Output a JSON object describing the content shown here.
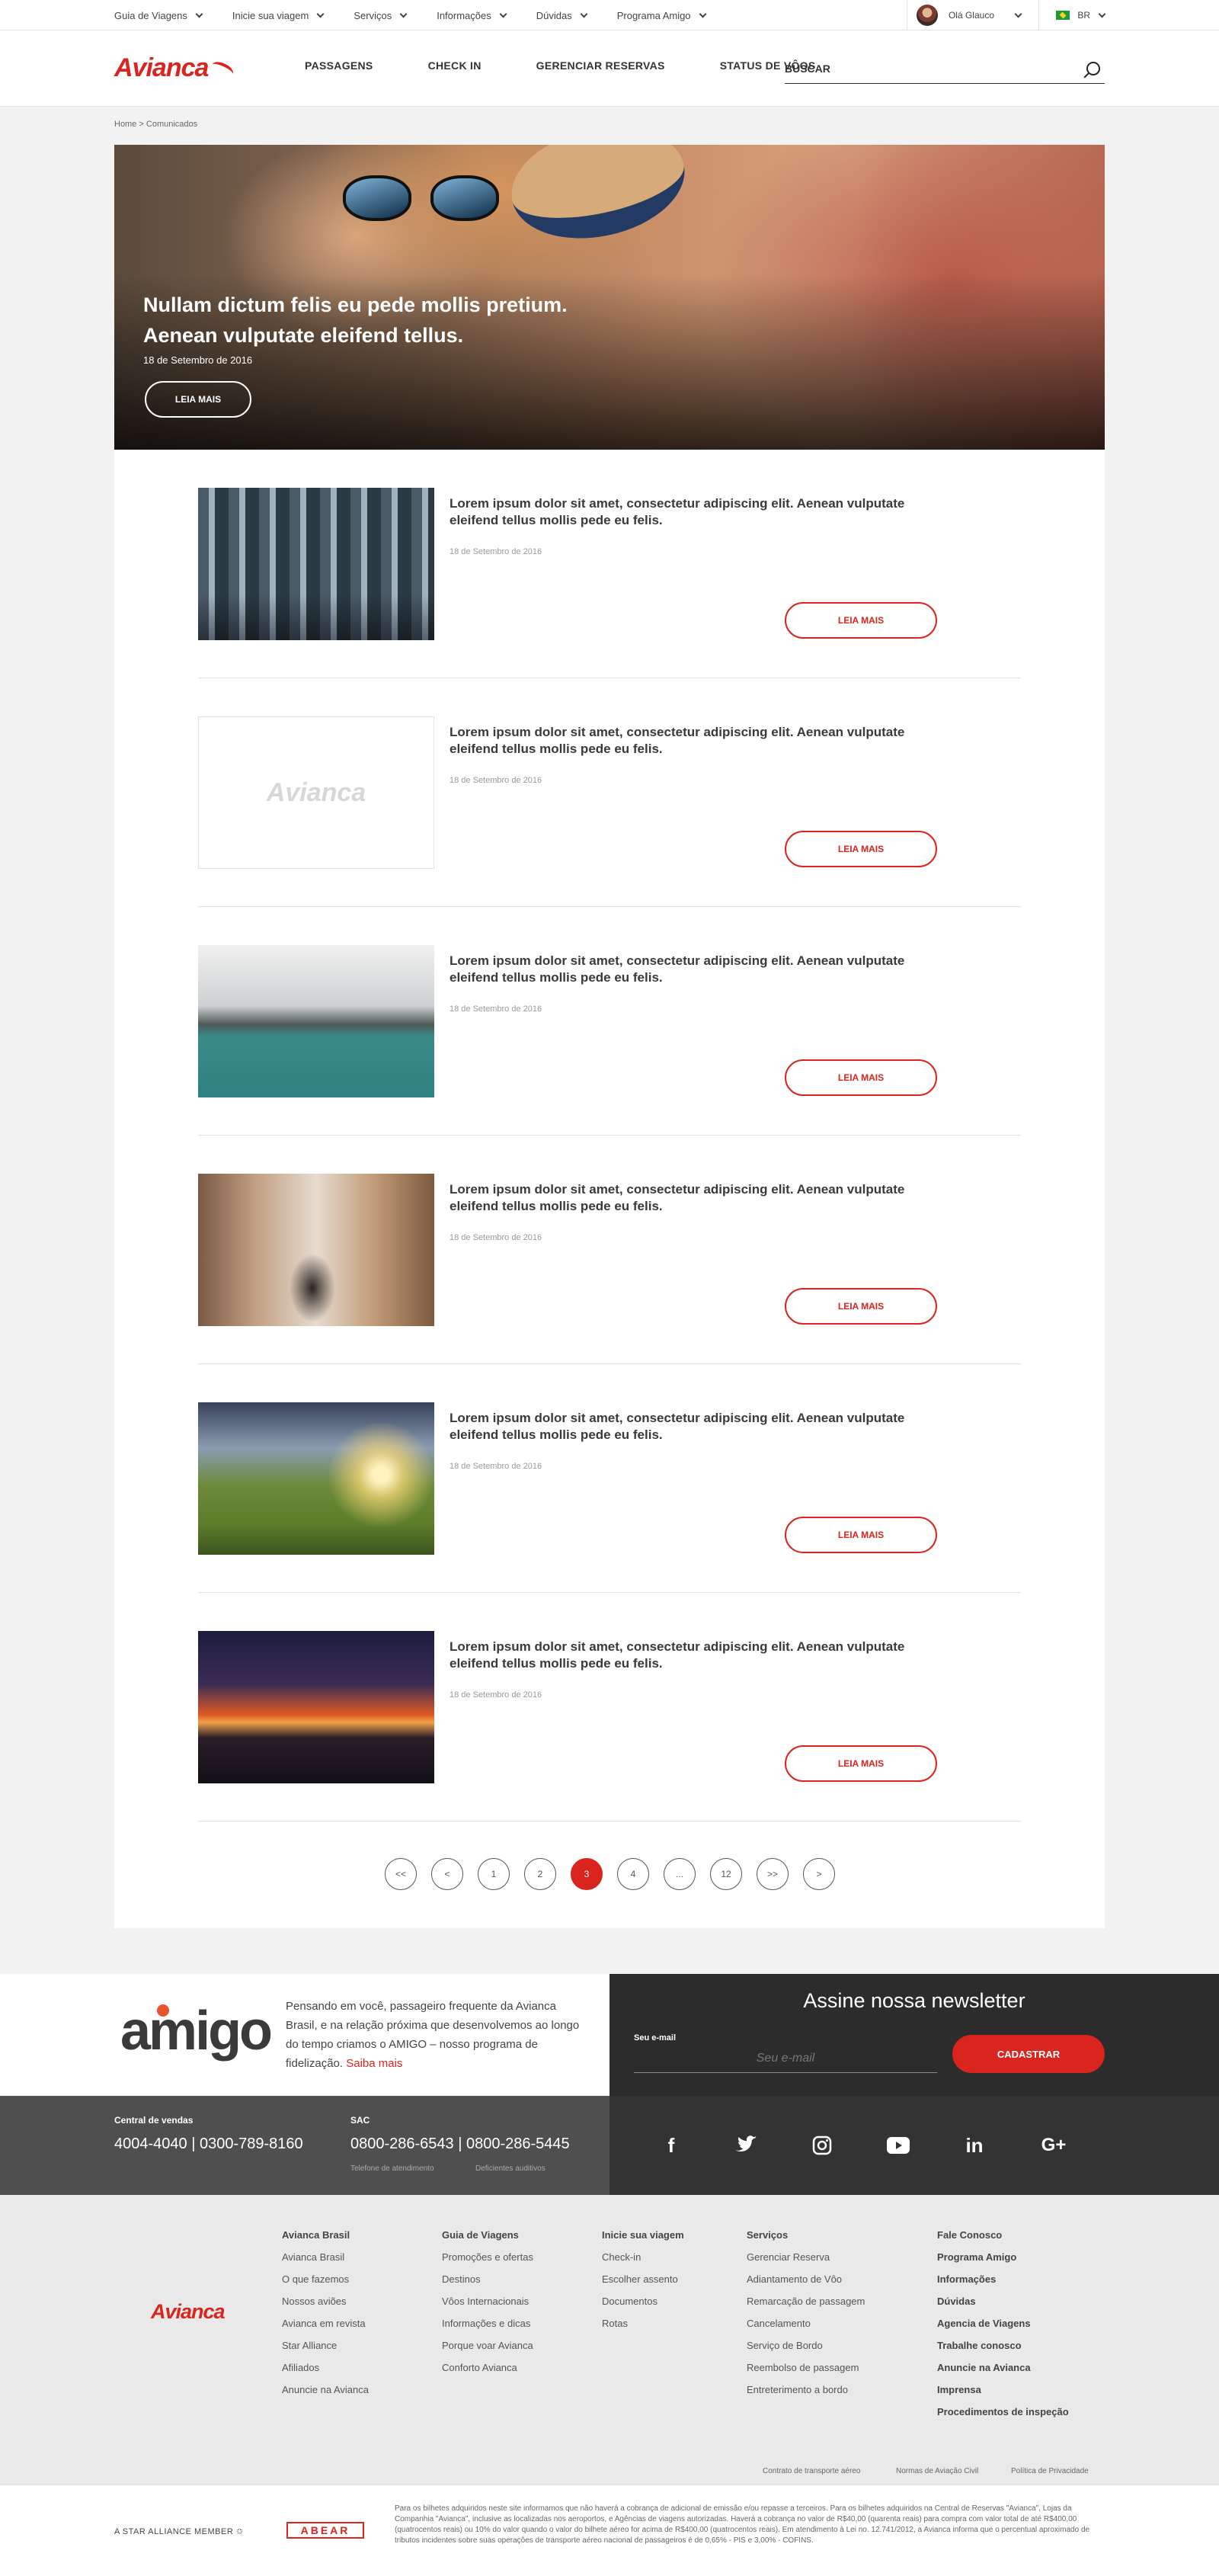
{
  "topbar": {
    "menu": [
      "Guia de Viagens",
      "Inicie sua viagem",
      "Serviços",
      "Informações",
      "Dúvidas",
      "Programa Amigo"
    ],
    "user_greeting": "Olá Glauco",
    "lang": "BR"
  },
  "header": {
    "logo": "Avianca",
    "nav": [
      "PASSAGENS",
      "CHECK IN",
      "GERENCIAR RESERVAS",
      "STATUS DE VÔOS"
    ],
    "search_placeholder": "BUSCAR"
  },
  "breadcrumb": "Home > Comunicados",
  "hero": {
    "title": "Nullam dictum felis eu pede mollis pretium. Aenean vulputate eleifend tellus.",
    "date": "18 de Setembro de 2016",
    "button": "LEIA MAIS"
  },
  "articles": [
    {
      "title": "Lorem ipsum dolor sit amet, consectetur adipiscing elit. Aenean vulputate eleifend tellus mollis pede eu felis.",
      "date": "18 de Setembro de 2016",
      "button": "LEIA MAIS"
    },
    {
      "title": "Lorem ipsum dolor sit amet, consectetur adipiscing elit. Aenean vulputate eleifend tellus mollis pede eu felis.",
      "date": "18 de Setembro de 2016",
      "button": "LEIA MAIS",
      "placeholder_logo": "Avianca"
    },
    {
      "title": "Lorem ipsum dolor sit amet, consectetur adipiscing elit. Aenean vulputate eleifend tellus mollis pede eu felis.",
      "date": "18 de Setembro de 2016",
      "button": "LEIA MAIS"
    },
    {
      "title": "Lorem ipsum dolor sit amet, consectetur adipiscing elit. Aenean vulputate eleifend tellus mollis pede eu felis.",
      "date": "18 de Setembro de 2016",
      "button": "LEIA MAIS"
    },
    {
      "title": "Lorem ipsum dolor sit amet, consectetur adipiscing elit. Aenean vulputate eleifend tellus mollis pede eu felis.",
      "date": "18 de Setembro de 2016",
      "button": "LEIA MAIS"
    },
    {
      "title": "Lorem ipsum dolor sit amet, consectetur adipiscing elit. Aenean vulputate eleifend tellus mollis pede eu felis.",
      "date": "18 de Setembro de 2016",
      "button": "LEIA MAIS"
    }
  ],
  "pagination": {
    "first": "<<",
    "prev": "<",
    "pages": [
      "1",
      "2",
      "3",
      "4",
      "...",
      "12"
    ],
    "next_fast": ">>",
    "next": ">",
    "current": "3"
  },
  "amigo": {
    "logo": "amigo",
    "text": "Pensando em você, passageiro frequente da Avianca Brasil, e na relação próxima que desenvolvemos ao longo do tempo criamos o AMIGO – nosso programa de fidelização.",
    "link": "Saiba mais"
  },
  "newsletter": {
    "title": "Assine nossa newsletter",
    "label": "Seu e-mail",
    "placeholder": "Seu e-mail",
    "button": "CADASTRAR"
  },
  "contact": {
    "sales_label": "Central de vendas",
    "sales_numbers": "4004-4040  |  0300-789-8160",
    "sac_label": "SAC",
    "sac_numbers": "0800-286-6543  |  0800-286-5445",
    "sac_sub1": "Telefone de atendimento",
    "sac_sub2": "Deficientes auditivos"
  },
  "social": [
    "f",
    "t",
    "ig",
    "yt",
    "in",
    "G+"
  ],
  "footer": {
    "logo": "Avianca",
    "columns": [
      {
        "heading": "Avianca Brasil",
        "links": [
          "Avianca Brasil",
          "O que fazemos",
          "Nossos aviões",
          "Avianca em revista",
          "Star Alliance",
          "Afiliados",
          "Anuncie na Avianca"
        ]
      },
      {
        "heading": "Guia de Viagens",
        "links": [
          "Promoções e ofertas",
          "Destinos",
          "Vôos Internacionais",
          "Informações e dicas",
          "Porque voar Avianca",
          "Conforto Avianca"
        ]
      },
      {
        "heading": "Inicie sua viagem",
        "links": [
          "Check-in",
          "Escolher assento",
          "Documentos",
          "Rotas"
        ]
      },
      {
        "heading": "Serviços",
        "links": [
          "Gerenciar Reserva",
          "Adiantamento de Vôo",
          "Remarcação de passagem",
          "Cancelamento",
          "Serviço de Bordo",
          "Reembolso de passagem",
          "Entreterimento a bordo"
        ]
      },
      {
        "heading": "Fale Conosco",
        "links": [
          "Programa Amigo",
          "Informações",
          "Dúvidas",
          "Agencia de Viagens",
          "Trabalhe conosco",
          "Anuncie na Avianca",
          "Imprensa",
          "Procedimentos de inspeção"
        ]
      }
    ],
    "legal": [
      "Contrato de transporte aéreo",
      "Normas de Aviação Civil",
      "Política de Privacidade"
    ]
  },
  "bottom": {
    "star_alliance": "A STAR ALLIANCE MEMBER",
    "abear": "ABEAR",
    "disclaimer": "Para os bilhetes adquiridos neste site informamos que não haverá a cobrança de adicional de emissão e/ou repasse a terceiros. Para os bilhetes adquiridos na Central de Reservas \"Avianca\", Lojas da Companhia \"Avianca\", inclusive as localizadas nos aeroportos, e Agências de viagens autorizadas. Haverá a cobrança no valor de R$40,00 (quarenta reais) para compra com valor total de até R$400,00 (quatrocentos reais) ou 10% do valor quando o valor do bilhete aéreo for acima de R$400,00 (quatrocentos reais). Em atendimento à Lei no. 12.741/2012, a Avianca informa que o percentual aproximado de tributos incidentes sobre suas operações de transporte aéreo nacional de passageiros é de 0,65% - PIS e 3,00% - COFINS."
  },
  "colors": {
    "brand": "#d9251d",
    "dark": "#2c2c2c"
  }
}
